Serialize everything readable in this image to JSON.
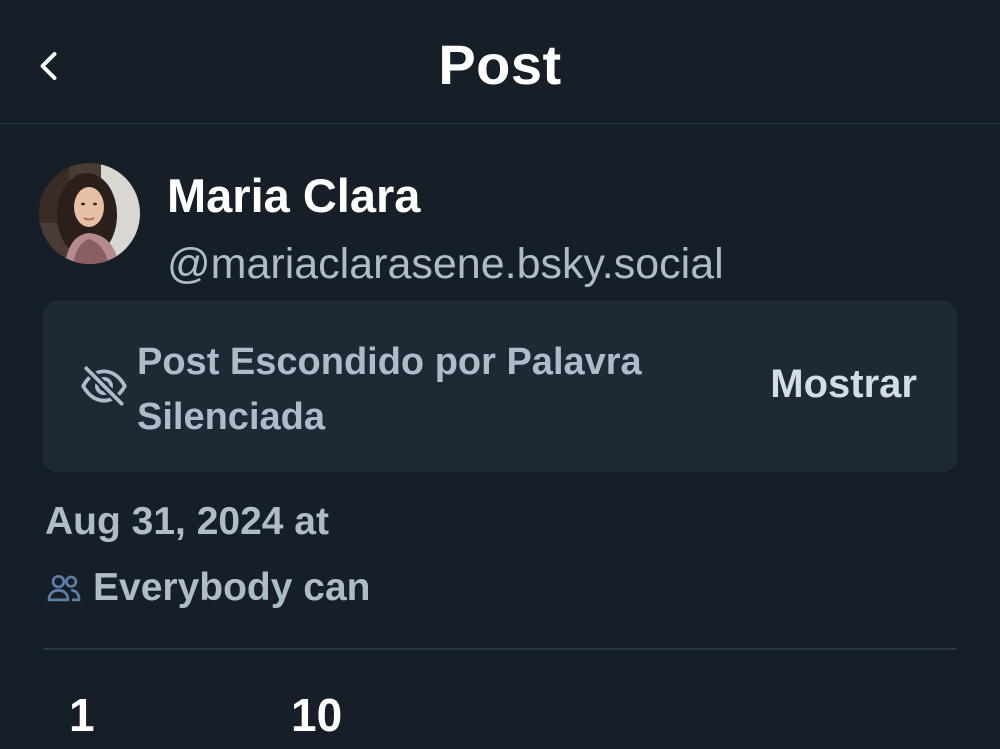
{
  "header": {
    "title": "Post"
  },
  "author": {
    "name": "Maria Clara",
    "handle": "@mariaclarasene.bsky.social"
  },
  "hidden_notice": {
    "text": "Post Escondido por Palavra Silenciada",
    "show_label": "Mostrar"
  },
  "post_meta": {
    "date": "Aug 31, 2024 at",
    "reply_setting": "Everybody can"
  },
  "stats": {
    "first_count": "1",
    "second_count": "10"
  },
  "icons": {
    "back": "chevron-left-icon",
    "hidden": "eye-slash-icon",
    "reply_setting": "people-icon"
  },
  "colors": {
    "background": "#161e27",
    "card": "#1e2936",
    "muted_text": "#aebbc9",
    "icon_accent": "#5f7fa6"
  }
}
